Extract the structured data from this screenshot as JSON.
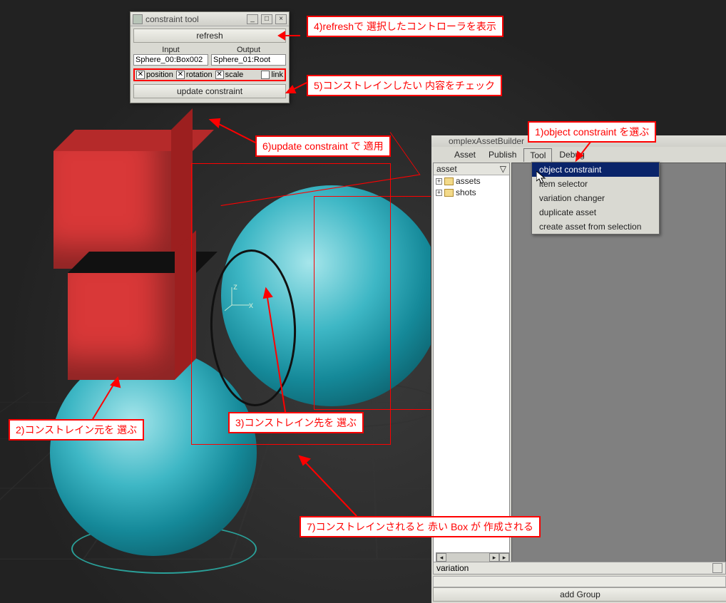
{
  "callouts": {
    "c1": "1)object constraint を選ぶ",
    "c2": "2)コンストレイン元を 選ぶ",
    "c3": "3)コンストレイン先を 選ぶ",
    "c4": "4)refreshで 選択したコントローラを表示",
    "c5": "5)コンストレインしたい 内容をチェック",
    "c6": "6)update constraint で 適用",
    "c7": "7)コンストレインされると 赤い Box が 作成される"
  },
  "constraint_tool": {
    "title": "constraint tool",
    "refresh": "refresh",
    "input_label": "Input",
    "output_label": "Output",
    "input_value": "Sphere_00:Box002",
    "output_value": "Sphere_01:Root",
    "chk_position": "position",
    "chk_rotation": "rotation",
    "chk_scale": "scale",
    "chk_link": "link",
    "update": "update constraint"
  },
  "asset_builder": {
    "title": "omplexAssetBuilder",
    "menu": {
      "asset": "Asset",
      "publish": "Publish",
      "tool": "Tool",
      "debug": "Debug"
    },
    "tool_menu": {
      "object_constraint": "object constraint",
      "item_selector": "item selector",
      "variation_changer": "variation changer",
      "duplicate_asset": "duplicate asset",
      "create_from_selection": "create asset from selection"
    },
    "tree_header": "asset",
    "tree_items": {
      "assets": "assets",
      "shots": "shots"
    },
    "variation": "variation",
    "add_group": "add Group"
  }
}
